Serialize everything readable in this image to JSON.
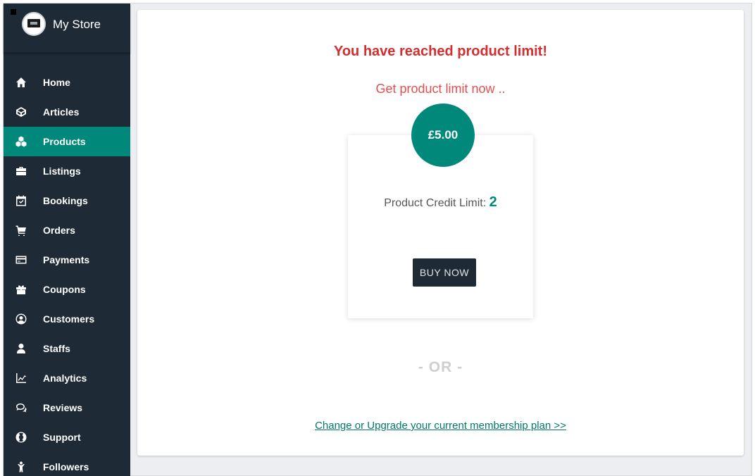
{
  "store": {
    "name": "My Store"
  },
  "sidebar": {
    "items": [
      {
        "label": "Home",
        "icon": "home-icon",
        "active": false
      },
      {
        "label": "Articles",
        "icon": "articles-icon",
        "active": false
      },
      {
        "label": "Products",
        "icon": "products-icon",
        "active": true
      },
      {
        "label": "Listings",
        "icon": "briefcase-icon",
        "active": false
      },
      {
        "label": "Bookings",
        "icon": "calendar-check-icon",
        "active": false
      },
      {
        "label": "Orders",
        "icon": "cart-icon",
        "active": false
      },
      {
        "label": "Payments",
        "icon": "credit-card-icon",
        "active": false
      },
      {
        "label": "Coupons",
        "icon": "gift-icon",
        "active": false
      },
      {
        "label": "Customers",
        "icon": "user-circle-icon",
        "active": false
      },
      {
        "label": "Staffs",
        "icon": "user-icon",
        "active": false
      },
      {
        "label": "Analytics",
        "icon": "line-chart-icon",
        "active": false
      },
      {
        "label": "Reviews",
        "icon": "comments-icon",
        "active": false
      },
      {
        "label": "Support",
        "icon": "life-ring-icon",
        "active": false
      },
      {
        "label": "Followers",
        "icon": "child-icon",
        "active": false
      }
    ]
  },
  "main": {
    "title": "You have reached product limit!",
    "subtitle": "Get product limit now ..",
    "plan": {
      "price": "£5.00",
      "credit_label": "Product Credit Limit:",
      "credit_value": "2",
      "buy_label": "BUY NOW"
    },
    "separator": "- OR -",
    "upgrade_link": "Change or Upgrade your current membership plan >>"
  },
  "colors": {
    "sidebar_bg": "#1e2a35",
    "accent": "#00897b",
    "alert": "#d32f2f"
  }
}
